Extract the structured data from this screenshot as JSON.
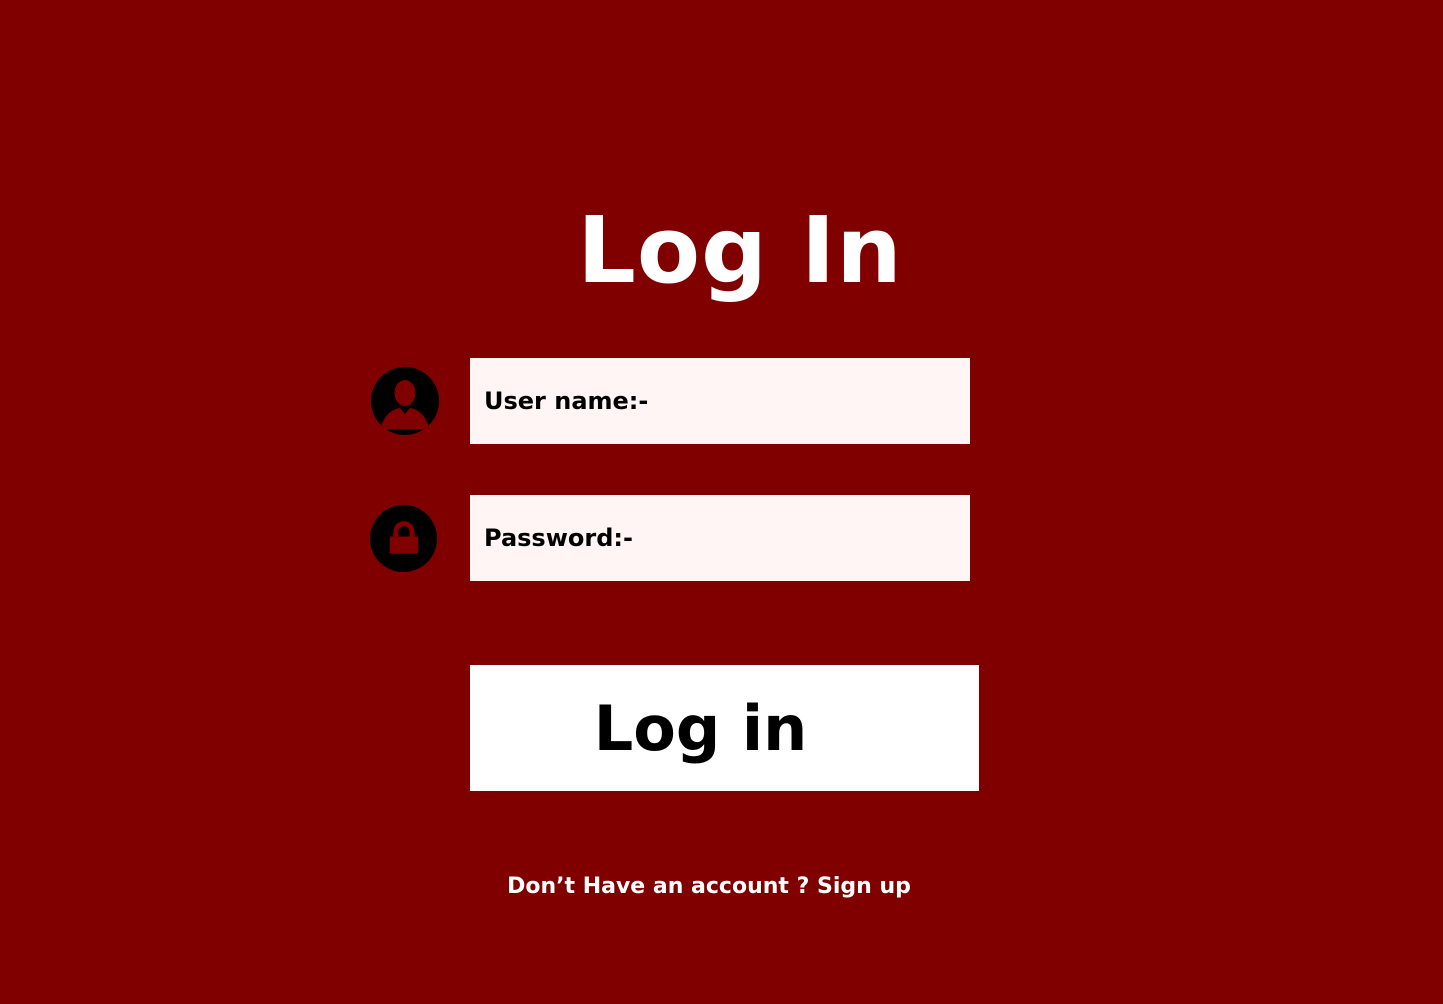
{
  "header": {
    "title": "Log In"
  },
  "form": {
    "username": {
      "label": "User name:-",
      "icon": "user-icon"
    },
    "password": {
      "label": "Password:-",
      "icon": "lock-icon"
    },
    "submit_label": "Log in"
  },
  "footer": {
    "signup_text": "Don’t Have an account ? Sign up"
  },
  "colors": {
    "background": "#800000",
    "field_background": "#fff5f5",
    "button_background": "#ffffff",
    "icon_background": "#000000",
    "text_light": "#ffffff",
    "text_dark": "#000000"
  }
}
